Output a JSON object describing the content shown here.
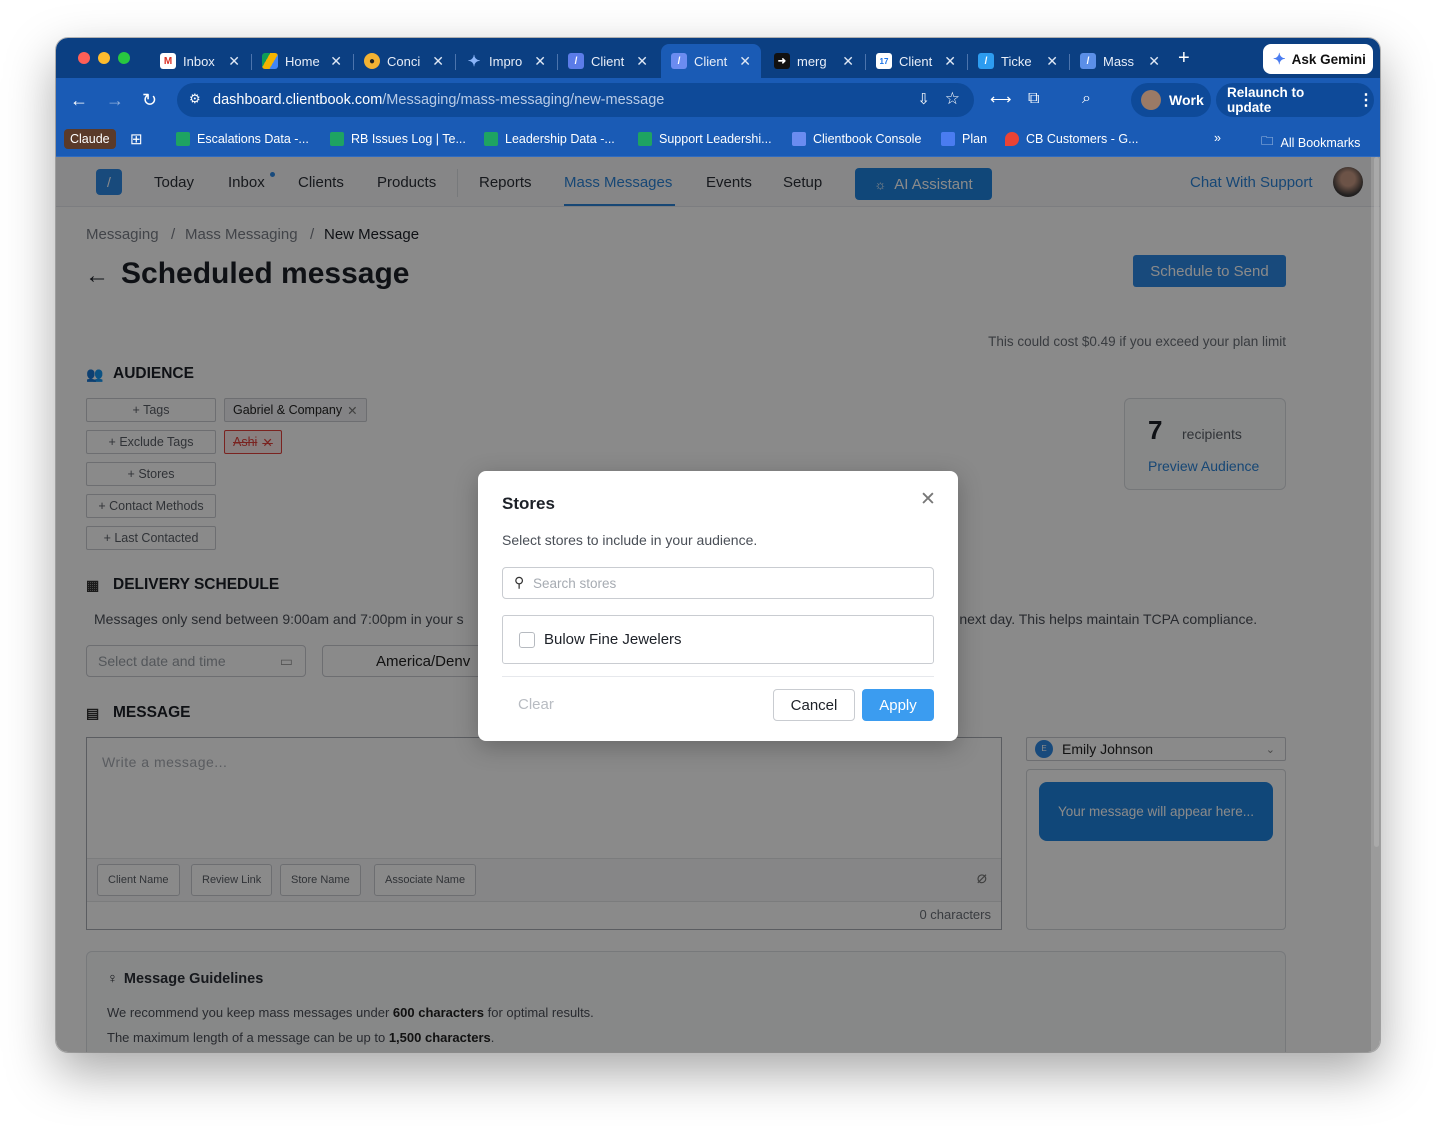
{
  "browser": {
    "tabs": [
      {
        "title": "Inbox",
        "icon": "gmail-icon"
      },
      {
        "title": "Home",
        "icon": "drive-icon"
      },
      {
        "title": "Conci",
        "icon": "concierge-icon"
      },
      {
        "title": "Impro",
        "icon": "gemini-icon"
      },
      {
        "title": "Client",
        "icon": "clientbook-icon"
      },
      {
        "title": "Client",
        "icon": "clientbook-icon"
      },
      {
        "title": "merg",
        "icon": "cursor-icon"
      },
      {
        "title": "Client",
        "icon": "calendar-icon"
      },
      {
        "title": "Ticke",
        "icon": "clientbook-icon"
      },
      {
        "title": "Mass",
        "icon": "clientbook-icon"
      }
    ],
    "ask_gemini": "Ask Gemini",
    "url_host": "dashboard.clientbook.com",
    "url_path": "/Messaging/mass-messaging/new-message",
    "profile": "Work",
    "relaunch": "Relaunch to update",
    "bookmarks": [
      {
        "label": "Claude"
      },
      {
        "label": "Escalations Data -..."
      },
      {
        "label": "RB Issues Log | Te..."
      },
      {
        "label": "Leadership Data -..."
      },
      {
        "label": "Support Leadershi..."
      },
      {
        "label": "Clientbook Console"
      },
      {
        "label": "Plan"
      },
      {
        "label": "CB Customers - G..."
      }
    ],
    "all_bookmarks": "All Bookmarks"
  },
  "nav": {
    "items": [
      "Today",
      "Inbox",
      "Clients",
      "Products",
      "Reports",
      "Mass Messages",
      "Events",
      "Setup"
    ],
    "active": "Mass Messages",
    "ai_assistant": "AI Assistant",
    "chat_support": "Chat With Support"
  },
  "breadcrumb": [
    "Messaging",
    "Mass Messaging",
    "New Message"
  ],
  "page_title": "Scheduled message",
  "schedule_button": "Schedule to Send",
  "cost_note": "This could cost $0.49 if you exceed your plan limit",
  "audience": {
    "heading": "AUDIENCE",
    "buttons": [
      "+ Tags",
      "+ Exclude Tags",
      "+ Stores",
      "+ Contact Methods",
      "+ Last Contacted"
    ],
    "tag_chip": "Gabriel & Company",
    "exclude_chip": "Ashi",
    "recipients_count": "7",
    "recipients_label": "recipients",
    "preview_link": "Preview Audience"
  },
  "delivery": {
    "heading": "DELIVERY SCHEDULE",
    "note_left": "Messages only send between 9:00am and 7:00pm in your s",
    "note_right": "e next day. This helps maintain TCPA compliance.",
    "date_placeholder": "Select date and time",
    "timezone": "America/Denv"
  },
  "message": {
    "heading": "MESSAGE",
    "placeholder": "Write a message...",
    "variables": [
      "Client Name",
      "Review Link",
      "Store Name",
      "Associate Name"
    ],
    "char_count": "0 characters",
    "associate": "Emily Johnson",
    "associate_initial": "E",
    "preview_text": "Your message will appear here..."
  },
  "guidelines": {
    "heading": "Message Guidelines",
    "line1_pre": "We recommend you keep mass messages under ",
    "line1_bold": "600 characters",
    "line1_post": " for optimal results.",
    "line2_pre": "The maximum length of a message can be up to ",
    "line2_bold": "1,500 characters",
    "line2_post": "."
  },
  "modal": {
    "title": "Stores",
    "subtitle": "Select stores to include in your audience.",
    "search_placeholder": "Search stores",
    "stores": [
      "Bulow Fine Jewelers"
    ],
    "clear": "Clear",
    "cancel": "Cancel",
    "apply": "Apply"
  },
  "colors": {
    "chrome": "#1a5bb5",
    "accent": "#2e8ae6",
    "danger": "#e2413c"
  }
}
